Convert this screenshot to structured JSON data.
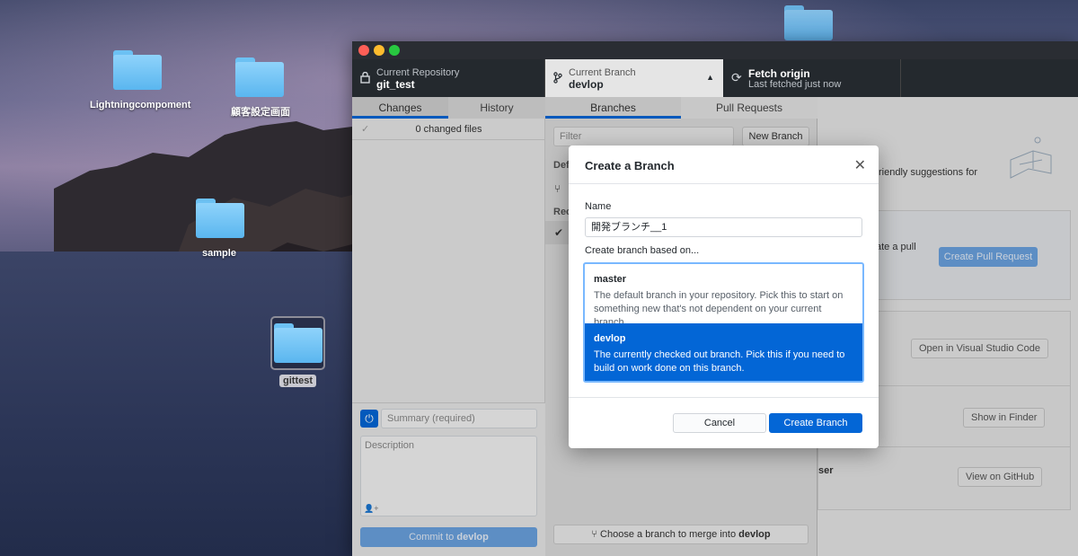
{
  "desktop": {
    "folders": [
      {
        "label": "Lightningcompoment"
      },
      {
        "label": "顧客設定画面"
      },
      {
        "label": "sample"
      },
      {
        "label": "gittest"
      }
    ]
  },
  "toolbar": {
    "repo_caption": "Current Repository",
    "repo_name": "git_test",
    "branch_caption": "Current Branch",
    "branch_name": "devlop",
    "fetch_title": "Fetch origin",
    "fetch_status": "Last fetched just now"
  },
  "left_pane": {
    "tabs": [
      {
        "label": "Changes"
      },
      {
        "label": "History"
      }
    ],
    "changed_files": "0 changed files",
    "summary_placeholder": "Summary (required)",
    "description_placeholder": "Description",
    "commit_prefix": "Commit to",
    "commit_branch": "devlop"
  },
  "branch_pane": {
    "tabs": [
      {
        "label": "Branches"
      },
      {
        "label": "Pull Requests"
      }
    ],
    "filter_placeholder": "Filter",
    "new_branch_label": "New Branch",
    "default_header": "Def",
    "recent_header": "Rec",
    "merge_prefix": "Choose a branch to merge into",
    "merge_branch": "devlop"
  },
  "right_pane": {
    "suggestions_text": "riendly suggestions for",
    "pull_text": "ate a pull",
    "create_pr_label": "Create Pull Request",
    "open_vscode_label": "Open in Visual Studio Code",
    "show_finder_label": "Show in Finder",
    "browser_text": "ser",
    "view_github_label": "View on GitHub"
  },
  "modal": {
    "title": "Create a Branch",
    "name_label": "Name",
    "name_value": "開発ブランチ__1",
    "based_on_label": "Create branch based on...",
    "options": [
      {
        "name": "master",
        "desc": "The default branch in your repository. Pick this to start on something new that's not dependent on your current branch.",
        "selected": false
      },
      {
        "name": "devlop",
        "desc": "The currently checked out branch. Pick this if you need to build on work done on this branch.",
        "selected": true
      }
    ],
    "cancel_label": "Cancel",
    "create_label": "Create Branch"
  },
  "colors": {
    "accent": "#0366d6",
    "toolbar_bg": "#24292e",
    "focus_ring": "#79b8ff"
  }
}
